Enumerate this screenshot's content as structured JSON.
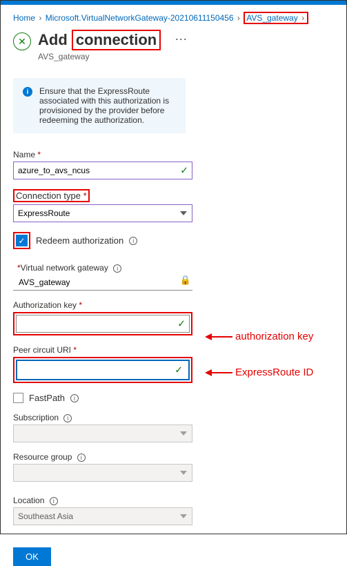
{
  "breadcrumb": {
    "home": "Home",
    "resource": "Microsoft.VirtualNetworkGateway-20210611150456",
    "gateway": "AVS_gateway"
  },
  "header": {
    "title_prefix": "Add",
    "title_boxed": "connection",
    "subtitle": "AVS_gateway"
  },
  "info": {
    "text": "Ensure that the ExpressRoute associated with this authorization is provisioned by the provider before redeeming the authorization."
  },
  "fields": {
    "name": {
      "label": "Name",
      "value": "azure_to_avs_ncus"
    },
    "conn_type": {
      "label": "Connection type",
      "value": "ExpressRoute"
    },
    "redeem": {
      "label": "Redeem authorization"
    },
    "vng": {
      "label": "Virtual network gateway",
      "value": "AVS_gateway"
    },
    "auth_key": {
      "label": "Authorization key"
    },
    "peer_uri": {
      "label": "Peer circuit URI"
    },
    "fastpath": {
      "label": "FastPath"
    },
    "subscription": {
      "label": "Subscription"
    },
    "resource_group": {
      "label": "Resource group"
    },
    "location": {
      "label": "Location",
      "value": "Southeast Asia"
    }
  },
  "buttons": {
    "ok": "OK"
  },
  "annotations": {
    "auth_key": "authorization key",
    "express_id": "ExpressRoute ID"
  }
}
